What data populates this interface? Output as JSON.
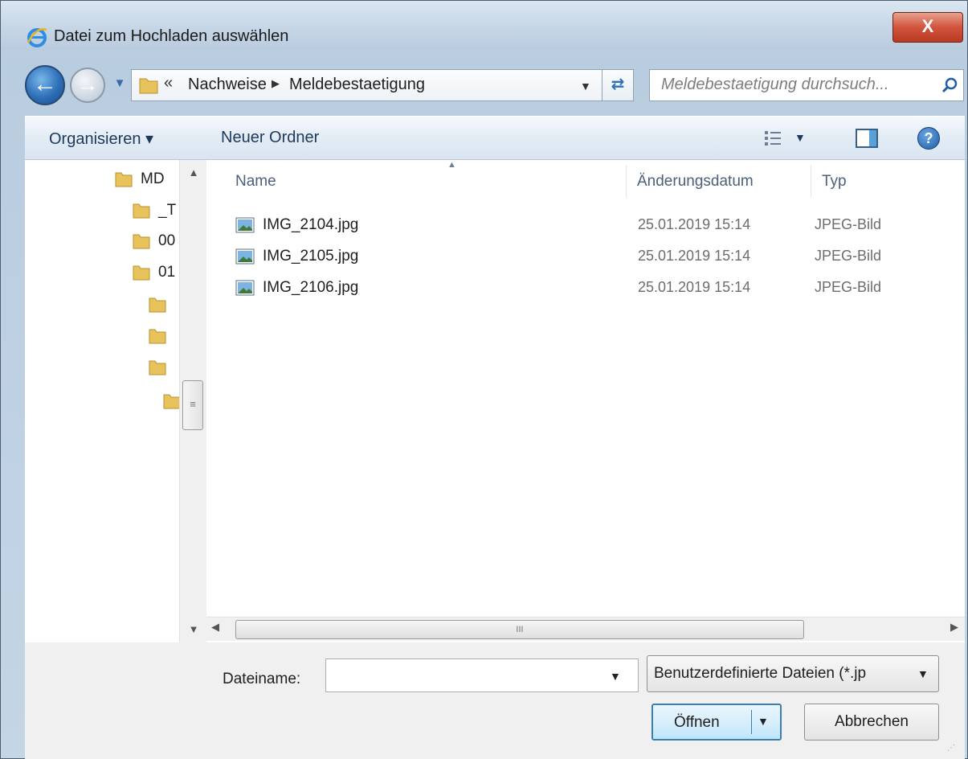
{
  "window": {
    "title": "Datei zum Hochladen auswählen",
    "close_label": "X"
  },
  "address": {
    "overflow": "«",
    "segments": [
      "Nachweise",
      "Meldebestaetigung"
    ],
    "search_placeholder": "Meldebestaetigung durchsuch..."
  },
  "toolbar": {
    "organize_label": "Organisieren ▾",
    "new_folder_label": "Neuer Ordner",
    "help_label": "?"
  },
  "nav": {
    "items": [
      {
        "label": "MD"
      },
      {
        "label": "_T"
      },
      {
        "label": "00"
      },
      {
        "label": "01"
      },
      {
        "label": ""
      },
      {
        "label": ""
      },
      {
        "label": ""
      },
      {
        "label": ""
      }
    ]
  },
  "files": {
    "columns": [
      "Name",
      "Änderungsdatum",
      "Typ"
    ],
    "rows": [
      {
        "name": "IMG_2104.jpg",
        "date": "25.01.2019 15:14",
        "type": "JPEG-Bild"
      },
      {
        "name": "IMG_2105.jpg",
        "date": "25.01.2019 15:14",
        "type": "JPEG-Bild"
      },
      {
        "name": "IMG_2106.jpg",
        "date": "25.01.2019 15:14",
        "type": "JPEG-Bild"
      }
    ]
  },
  "bottom": {
    "filename_label": "Dateiname:",
    "filename_value": "",
    "filetype_selected": "Benutzerdefinierte Dateien (*.jp",
    "open_label": "Öffnen",
    "cancel_label": "Abbrechen"
  },
  "colors": {
    "accent": "#3c7fb1",
    "folder": "#e8c25a",
    "toolbar_text": "#1e395b"
  }
}
